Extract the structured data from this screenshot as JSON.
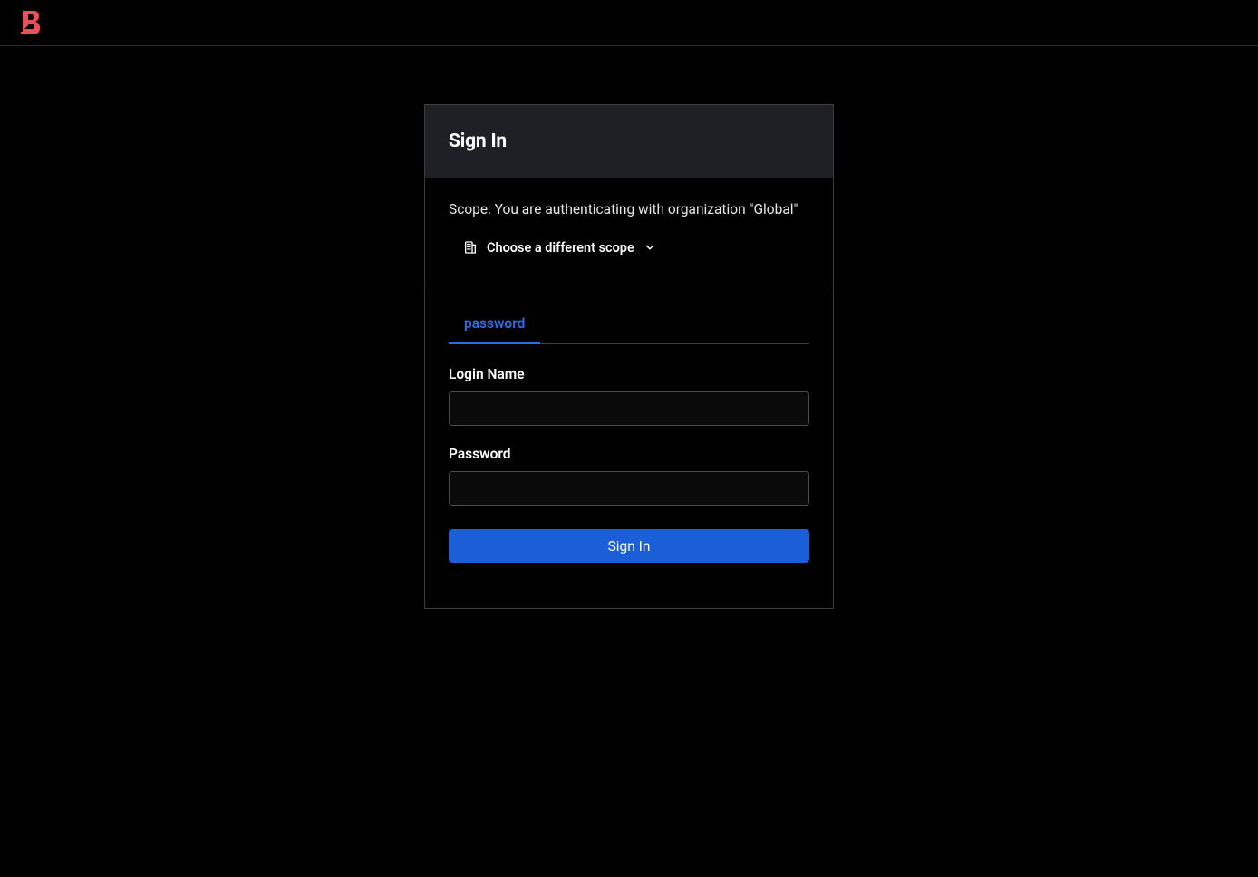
{
  "header": {
    "brand": "B"
  },
  "card": {
    "title": "Sign In",
    "scope": {
      "text": "Scope: You are authenticating with organization \"Global\"",
      "choose_button": "Choose a different scope"
    },
    "tabs": {
      "password": "password"
    },
    "form": {
      "login_label": "Login Name",
      "login_value": "",
      "password_label": "Password",
      "password_value": "",
      "submit_label": "Sign In"
    }
  }
}
